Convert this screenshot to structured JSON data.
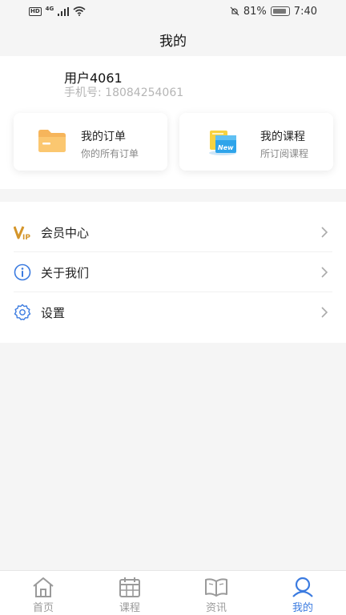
{
  "status_bar": {
    "hd": "HD",
    "network": "4G",
    "battery_percent": "81%",
    "time": "7:40"
  },
  "header": {
    "title": "我的"
  },
  "user": {
    "name": "用户4061",
    "phone": "手机号: 18084254061"
  },
  "cards": [
    {
      "title": "我的订单",
      "subtitle": "你的所有订单",
      "icon": "folder-icon"
    },
    {
      "title": "我的课程",
      "subtitle": "所订阅课程",
      "icon": "course-book-icon"
    }
  ],
  "menu": [
    {
      "label": "会员中心",
      "icon": "vip-icon"
    },
    {
      "label": "关于我们",
      "icon": "info-icon"
    },
    {
      "label": "设置",
      "icon": "gear-icon"
    }
  ],
  "tabs": [
    {
      "label": "首页",
      "icon": "home-icon",
      "active": false
    },
    {
      "label": "课程",
      "icon": "calendar-icon",
      "active": false
    },
    {
      "label": "资讯",
      "icon": "open-book-icon",
      "active": false
    },
    {
      "label": "我的",
      "icon": "user-icon",
      "active": true
    }
  ],
  "colors": {
    "accent": "#3b7be0",
    "inactive": "#9a9a9a",
    "vip_gold": "#d4952a",
    "folder_orange": "#f6b55b"
  }
}
